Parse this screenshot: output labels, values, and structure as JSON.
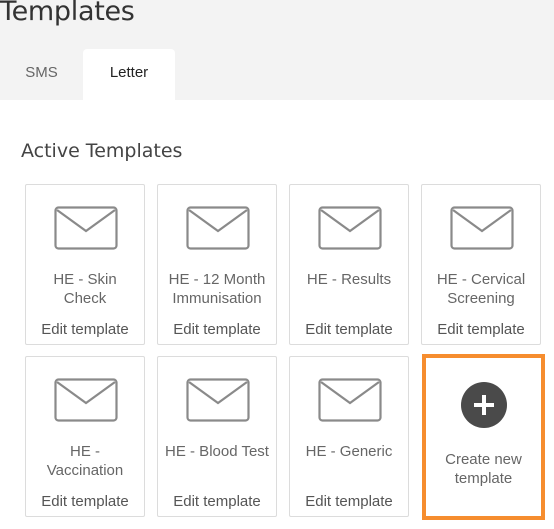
{
  "page": {
    "title": "Templates"
  },
  "tabs": [
    {
      "label": "SMS",
      "active": false
    },
    {
      "label": "Letter",
      "active": true
    }
  ],
  "section": {
    "title": "Active Templates"
  },
  "templates": [
    {
      "name": "HE - Skin Check",
      "edit_label": "Edit template",
      "icon": "envelope-icon"
    },
    {
      "name": "HE - 12 Month Immunisation",
      "edit_label": "Edit template",
      "icon": "envelope-icon"
    },
    {
      "name": "HE - Results",
      "edit_label": "Edit template",
      "icon": "envelope-icon"
    },
    {
      "name": "HE - Cervical Screening",
      "edit_label": "Edit template",
      "icon": "envelope-icon"
    },
    {
      "name": "HE - Vaccination",
      "edit_label": "Edit template",
      "icon": "envelope-icon"
    },
    {
      "name": "HE - Blood Test",
      "edit_label": "Edit template",
      "icon": "envelope-icon"
    },
    {
      "name": "HE - Generic",
      "edit_label": "Edit template",
      "icon": "envelope-icon"
    }
  ],
  "create": {
    "label": "Create new template",
    "icon": "plus-icon"
  },
  "colors": {
    "accent_border": "#f68d2e",
    "icon_stroke": "#8a8a8a",
    "plus_bg": "#4a4a4a"
  }
}
